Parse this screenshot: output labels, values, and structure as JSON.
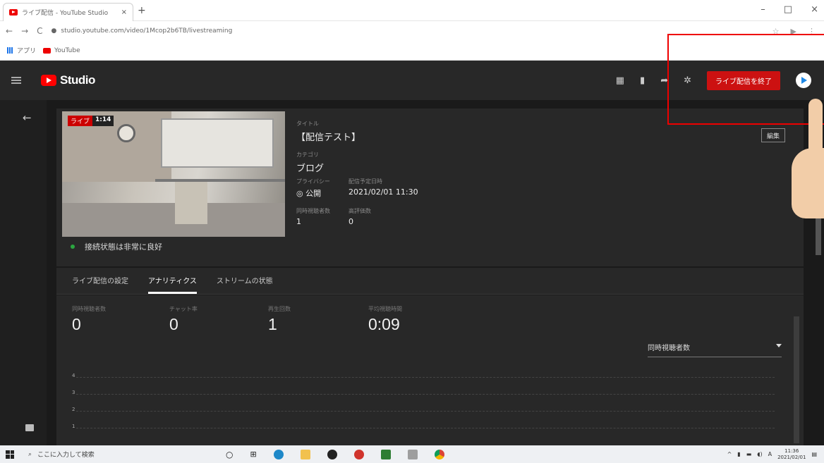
{
  "browser": {
    "tab_title": "ライブ配信 - YouTube Studio",
    "tab_close": "×",
    "new_tab": "+",
    "url": "studio.youtube.com/video/1Mcop2b6TB/livestreaming",
    "bookmarks": [
      {
        "label": "アプリ",
        "icon": "apps-grid-icon"
      },
      {
        "label": "YouTube",
        "icon": "youtube-icon"
      }
    ],
    "window_controls": [
      "–",
      "□",
      "×"
    ]
  },
  "header": {
    "logo_text": "Studio",
    "end_stream_label": "ライブ配信を終了"
  },
  "stream": {
    "live_badge": "ライブ",
    "elapsed": "1:14",
    "connection_status": "接続状態は非常に良好",
    "title_label": "タイトル",
    "title": "【配信テスト】",
    "category_label": "カテゴリ",
    "category": "ブログ",
    "privacy_label": "プライバシー",
    "privacy": "公開",
    "schedule_label": "配信予定日時",
    "schedule": "2021/02/01 11:30",
    "viewers_label": "同時視聴者数",
    "viewers": "1",
    "likes_label": "高評価数",
    "likes": "0",
    "edit_label": "編集"
  },
  "tabs": [
    {
      "label": "ライブ配信の設定",
      "active": false
    },
    {
      "label": "アナリティクス",
      "active": true
    },
    {
      "label": "ストリームの状態",
      "active": false
    }
  ],
  "analytics": {
    "stats": [
      {
        "label": "同時視聴者数",
        "value": "0"
      },
      {
        "label": "チャット率",
        "value": "0"
      },
      {
        "label": "再生回数",
        "value": "1"
      },
      {
        "label": "平均視聴時間",
        "value": "0:09"
      }
    ],
    "metric_select": "同時視聴者数",
    "y_ticks": [
      "4",
      "3",
      "2",
      "1"
    ]
  },
  "taskbar": {
    "search_placeholder": "ここに入力して検索",
    "time": "11:36",
    "date": "2021/02/01",
    "ime": "A"
  }
}
